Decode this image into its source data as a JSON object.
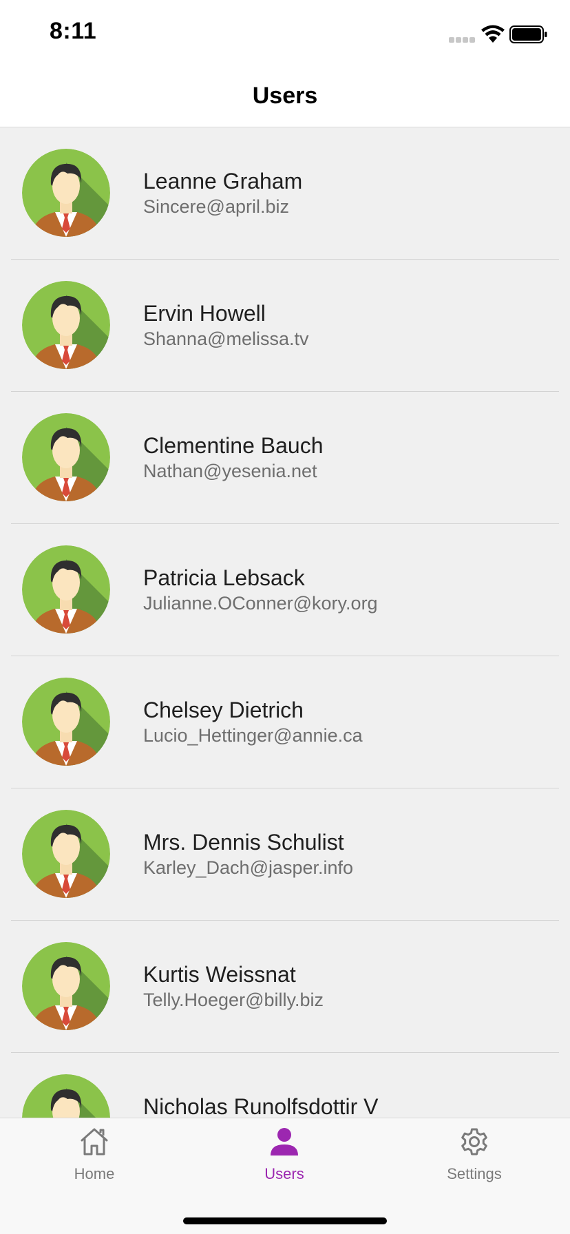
{
  "status_bar": {
    "time": "8:11"
  },
  "nav": {
    "title": "Users"
  },
  "users": [
    {
      "name": "Leanne Graham",
      "email": "Sincere@april.biz"
    },
    {
      "name": "Ervin Howell",
      "email": "Shanna@melissa.tv"
    },
    {
      "name": "Clementine Bauch",
      "email": "Nathan@yesenia.net"
    },
    {
      "name": "Patricia Lebsack",
      "email": "Julianne.OConner@kory.org"
    },
    {
      "name": "Chelsey Dietrich",
      "email": "Lucio_Hettinger@annie.ca"
    },
    {
      "name": "Mrs. Dennis Schulist",
      "email": "Karley_Dach@jasper.info"
    },
    {
      "name": "Kurtis Weissnat",
      "email": "Telly.Hoeger@billy.biz"
    },
    {
      "name": "Nicholas Runolfsdottir V",
      "email": ""
    }
  ],
  "tabs": [
    {
      "label": "Home",
      "icon": "home-icon",
      "active": false
    },
    {
      "label": "Users",
      "icon": "person-icon",
      "active": true
    },
    {
      "label": "Settings",
      "icon": "gear-icon",
      "active": false
    }
  ],
  "colors": {
    "accent": "#9c27b0",
    "inactive_tab": "#7a7a7a",
    "list_background": "#f0f0f0",
    "avatar_green": "#8bc34a"
  }
}
